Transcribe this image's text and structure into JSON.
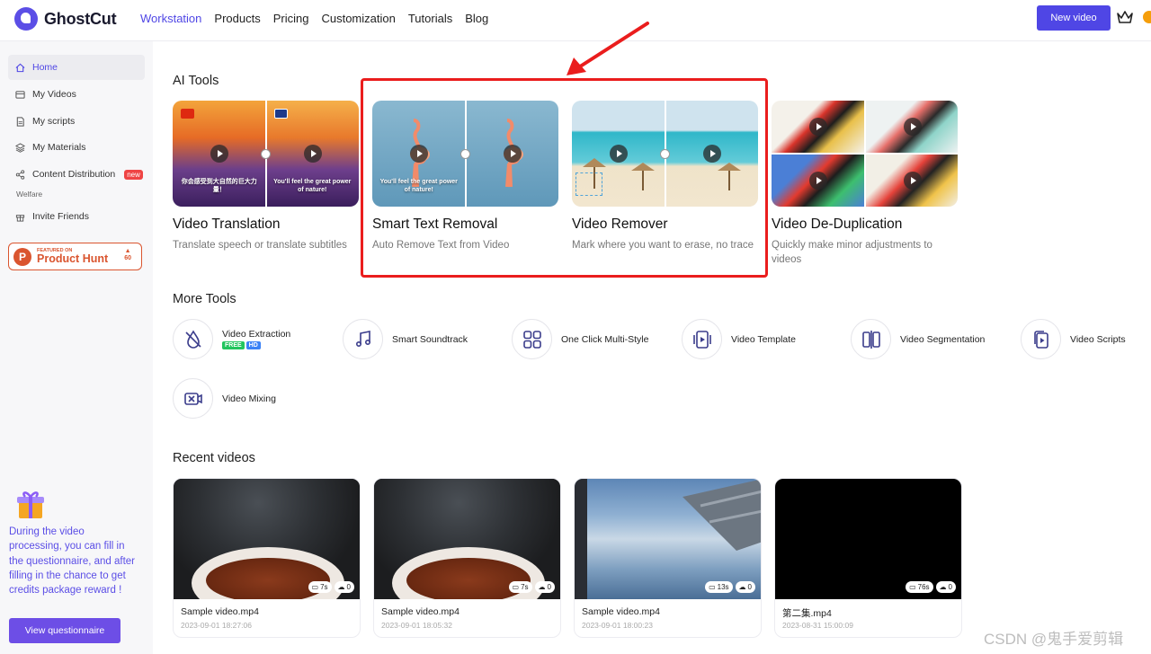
{
  "header": {
    "brand": "GhostCut",
    "nav": [
      "Workstation",
      "Products",
      "Pricing",
      "Customization",
      "Tutorials",
      "Blog"
    ],
    "active_nav": "Workstation",
    "new_video_label": "New video"
  },
  "sidebar": {
    "items": [
      {
        "label": "Home",
        "icon": "home-icon"
      },
      {
        "label": "My Videos",
        "icon": "video-icon"
      },
      {
        "label": "My scripts",
        "icon": "document-icon"
      },
      {
        "label": "My Materials",
        "icon": "layers-icon"
      },
      {
        "label": "Content Distribution",
        "icon": "share-icon",
        "badge": "new"
      }
    ],
    "section_label": "Welfare",
    "welfare_item": {
      "label": "Invite Friends",
      "icon": "gift-icon"
    },
    "product_hunt": {
      "small": "FEATURED ON",
      "big": "Product Hunt",
      "votes": "60"
    },
    "promo_text": "During the video processing, you can fill in the questionnaire, and after filling in the chance to get credits package reward !",
    "questionnaire_label": "View questionnaire"
  },
  "ai_tools": {
    "title": "AI Tools",
    "tools": [
      {
        "name": "Video Translation",
        "desc": "Translate speech or translate subtitles",
        "caption_left": "你会感受到大自然的巨大力量！",
        "caption_right": "You'll feel the great power of nature!"
      },
      {
        "name": "Smart Text Removal",
        "desc": "Auto Remove Text from Video",
        "caption_left": "You'll feel the great power of nature!"
      },
      {
        "name": "Video Remover",
        "desc": "Mark where you want to erase, no trace"
      },
      {
        "name": "Video De-Duplication",
        "desc": "Quickly make minor adjustments to videos"
      }
    ]
  },
  "more_tools": {
    "title": "More Tools",
    "items": [
      {
        "label": "Video Extraction",
        "icon": "droplet-slash-icon",
        "badges": [
          "FREE",
          "HD"
        ]
      },
      {
        "label": "Smart Soundtrack",
        "icon": "music-note-icon"
      },
      {
        "label": "One Click Multi-Style",
        "icon": "grid-icon"
      },
      {
        "label": "Video Template",
        "icon": "template-icon"
      },
      {
        "label": "Video Segmentation",
        "icon": "segment-icon"
      },
      {
        "label": "Video Scripts",
        "icon": "script-icon"
      },
      {
        "label": "Video Mixing",
        "icon": "mixing-icon"
      }
    ]
  },
  "recent": {
    "title": "Recent videos",
    "videos": [
      {
        "name": "Sample video.mp4",
        "time": "2023-09-01 18:27:06",
        "duration": "7s",
        "count": "0"
      },
      {
        "name": "Sample video.mp4",
        "time": "2023-09-01 18:05:32",
        "duration": "7s",
        "count": "0"
      },
      {
        "name": "Sample video.mp4",
        "time": "2023-09-01 18:00:23",
        "duration": "13s",
        "count": "0"
      },
      {
        "name": "第二集.mp4",
        "time": "2023-08-31 15:00:09",
        "duration": "76s",
        "count": "0"
      }
    ]
  },
  "watermark": "CSDN @鬼手爱剪辑",
  "colors": {
    "accent": "#4f46e5",
    "highlight": "#ea1d1d",
    "product_hunt": "#da552f",
    "promo": "#5b4ee6"
  }
}
